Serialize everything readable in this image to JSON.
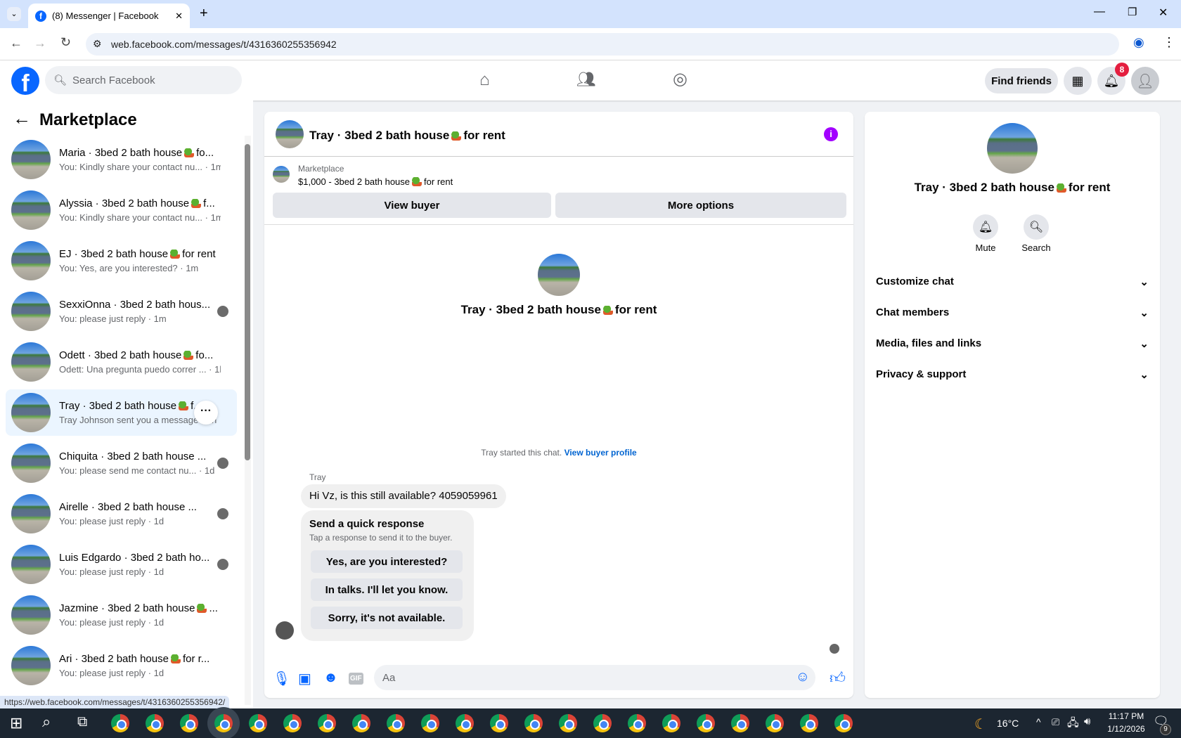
{
  "browser": {
    "tab_title": "(8) Messenger | Facebook",
    "url": "web.facebook.com/messages/t/4316360255356942",
    "status_url": "https://web.facebook.com/messages/t/4316360255356942/"
  },
  "header": {
    "search_placeholder": "Search Facebook",
    "find_friends": "Find friends",
    "notification_count": "8",
    "brand_color": "#0866ff"
  },
  "sidebar": {
    "title": "Marketplace",
    "conversations": [
      {
        "title": "Maria · 3bed 2 bath house",
        "after": "fo...",
        "emoji": true,
        "sub": "You: Kindly share your contact nu...  · 1m"
      },
      {
        "title": "Alyssia · 3bed 2 bath house",
        "after": "f...",
        "emoji": true,
        "sub": "You: Kindly share your contact nu...  · 1m"
      },
      {
        "title": "EJ · 3bed 2 bath house",
        "after": "for rent",
        "emoji": true,
        "sub": "You: Yes, are you interested? · 1m"
      },
      {
        "title": "SexxiOnna · 3bed 2 bath hous...",
        "after": "",
        "emoji": false,
        "sub": "You: please just reply · 1m",
        "seen": true
      },
      {
        "title": "Odett · 3bed 2 bath house",
        "after": "fo...",
        "emoji": true,
        "sub": "Odett: Una pregunta puedo correr ...  · 1h"
      },
      {
        "title": "Tray · 3bed 2 bath house",
        "after": "f...",
        "emoji": true,
        "sub": "Tray Johnson sent you a message · 5h",
        "active": true
      },
      {
        "title": "Chiquita · 3bed 2 bath house ...",
        "after": "",
        "emoji": false,
        "sub": "You: please send me contact nu...  · 1d",
        "seen": true
      },
      {
        "title": "Airelle · 3bed 2 bath house ...",
        "after": "",
        "emoji": false,
        "sub": "You: please just reply · 1d",
        "seen": true
      },
      {
        "title": "Luis Edgardo · 3bed 2 bath ho...",
        "after": "",
        "emoji": false,
        "sub": "You: please just reply · 1d",
        "seen": true
      },
      {
        "title": "Jazmine · 3bed 2 bath house",
        "after": "...",
        "emoji": true,
        "sub": "You: please just reply · 1d"
      },
      {
        "title": "Ari · 3bed 2 bath house",
        "after": "for r...",
        "emoji": true,
        "sub": "You: please just reply · 1d"
      }
    ]
  },
  "chat": {
    "title_a": "Tray · 3bed 2 bath house",
    "title_b": "for rent",
    "listing_label": "Marketplace",
    "listing_a": "$1,000 - 3bed 2 bath house",
    "listing_b": "for rent",
    "view_buyer": "View buyer",
    "more_options": "More options",
    "started": "Tray started this chat.",
    "view_buyer_profile": "View buyer profile",
    "sender": "Tray",
    "message": "Hi Vz, is this still available? 4059059961",
    "quick_title": "Send a quick response",
    "quick_sub": "Tap a response to send it to the buyer.",
    "quick_responses": [
      "Yes, are you interested?",
      "In talks. I'll let you know.",
      "Sorry, it's not available."
    ],
    "composer_placeholder": "Aa"
  },
  "details": {
    "title_a": "Tray · 3bed 2 bath house",
    "title_b": "for rent",
    "mute": "Mute",
    "search": "Search",
    "sections": [
      "Customize chat",
      "Chat members",
      "Media, files and links",
      "Privacy & support"
    ]
  },
  "taskbar": {
    "temperature": "16°C",
    "time": "11:17 PM",
    "date": "1/12/2026",
    "notifications": "9"
  }
}
